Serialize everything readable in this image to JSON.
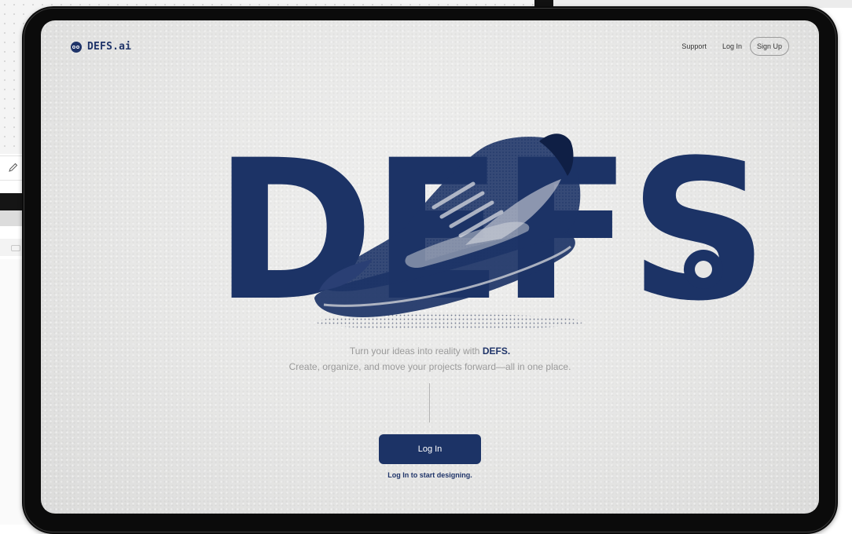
{
  "brand": {
    "name": "DEFS.ai",
    "color": "#1c3366"
  },
  "nav": {
    "support": "Support",
    "login": "Log In",
    "signup": "Sign Up"
  },
  "hero": {
    "word": "DEFS",
    "image_subject": "sneaker"
  },
  "copy": {
    "tagline_prefix": "Turn your ideas into reality with ",
    "tagline_brand": "DEFS.",
    "subline": "Create, organize, and move your projects forward—all in one place."
  },
  "cta": {
    "button": "Log In",
    "hint": "Log In to start designing."
  }
}
